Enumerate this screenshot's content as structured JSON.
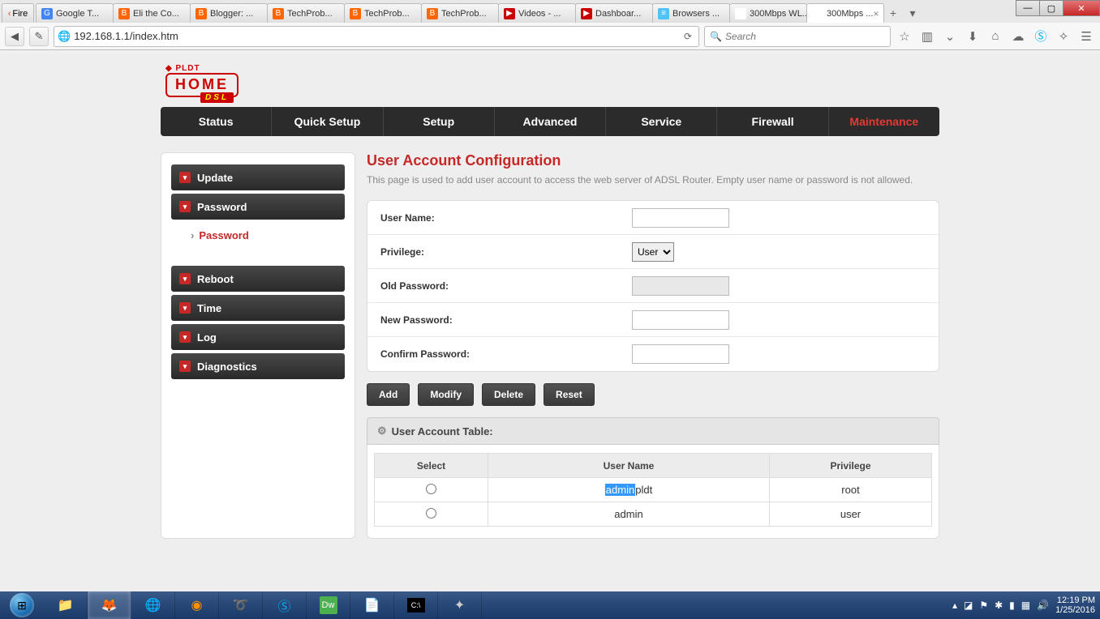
{
  "window_controls": {
    "min": "—",
    "max": "▢",
    "close": "✕"
  },
  "fire_tab": "Fire",
  "tabs": [
    {
      "favicon_bg": "#4285f4",
      "favicon_txt": "G",
      "label": "Google T..."
    },
    {
      "favicon_bg": "#ff6600",
      "favicon_txt": "B",
      "label": "Eli the Co..."
    },
    {
      "favicon_bg": "#ff6600",
      "favicon_txt": "B",
      "label": "Blogger: ..."
    },
    {
      "favicon_bg": "#ff6600",
      "favicon_txt": "B",
      "label": "TechProb..."
    },
    {
      "favicon_bg": "#ff6600",
      "favicon_txt": "B",
      "label": "TechProb..."
    },
    {
      "favicon_bg": "#ff6600",
      "favicon_txt": "B",
      "label": "TechProb..."
    },
    {
      "favicon_bg": "#cc0000",
      "favicon_txt": "▶",
      "label": "Videos - ..."
    },
    {
      "favicon_bg": "#cc0000",
      "favicon_txt": "▶",
      "label": "Dashboar..."
    },
    {
      "favicon_bg": "#4fc3f7",
      "favicon_txt": "≡",
      "label": "Browsers ..."
    },
    {
      "favicon_bg": "#ffffff",
      "favicon_txt": "",
      "label": "300Mbps WL..."
    },
    {
      "favicon_bg": "#ffffff",
      "favicon_txt": "",
      "label": "300Mbps ...",
      "active": true
    }
  ],
  "toolbar": {
    "url": "192.168.1.1/index.htm",
    "search_placeholder": "Search"
  },
  "logo": {
    "brand": "◆ PLDT",
    "home": "HOME",
    "dsl": "DSL"
  },
  "topnav": [
    {
      "label": "Status"
    },
    {
      "label": "Quick Setup"
    },
    {
      "label": "Setup"
    },
    {
      "label": "Advanced"
    },
    {
      "label": "Service"
    },
    {
      "label": "Firewall"
    },
    {
      "label": "Maintenance",
      "active": true
    }
  ],
  "sidebar": {
    "items1": [
      {
        "label": "Update"
      },
      {
        "label": "Password",
        "sub": "Password"
      }
    ],
    "items2": [
      {
        "label": "Reboot"
      },
      {
        "label": "Time"
      },
      {
        "label": "Log"
      },
      {
        "label": "Diagnostics"
      }
    ]
  },
  "page": {
    "title": "User Account Configuration",
    "desc": "This page is used to add user account to access the web server of ADSL Router. Empty user name or password is not allowed."
  },
  "form": {
    "username_label": "User Name:",
    "privilege_label": "Privilege:",
    "privilege_value": "User",
    "oldpw_label": "Old Password:",
    "newpw_label": "New Password:",
    "confirm_label": "Confirm Password:"
  },
  "buttons": {
    "add": "Add",
    "modify": "Modify",
    "delete": "Delete",
    "reset": "Reset"
  },
  "table": {
    "title": "User Account Table:",
    "cols": {
      "select": "Select",
      "username": "User Name",
      "privilege": "Privilege"
    },
    "rows": [
      {
        "user_hi": "admin",
        "user_rest": "pldt",
        "priv": "root"
      },
      {
        "user_hi": "",
        "user_rest": "admin",
        "priv": "user"
      }
    ]
  },
  "taskbar": {
    "time": "12:19 PM",
    "date": "1/25/2016"
  }
}
